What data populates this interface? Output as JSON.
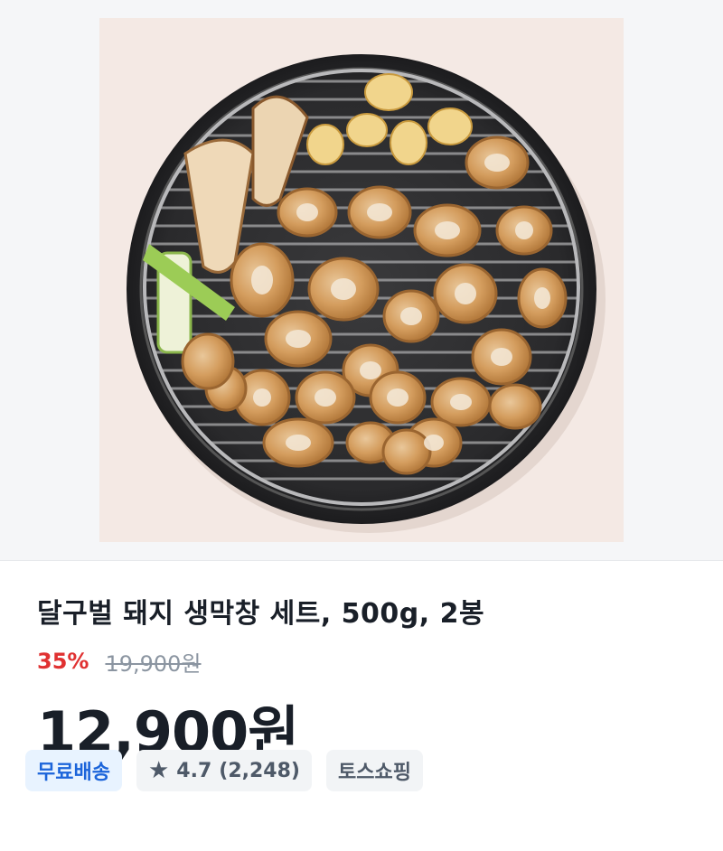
{
  "product": {
    "image_alt": "grilled pork intestines with garlic, king oyster mushroom and green onion on a round grill",
    "title": "달구벌 돼지 생막창 세트, 500g, 2봉",
    "discount": "35%",
    "original_price": "19,900원",
    "price": "12,900원"
  },
  "tags": {
    "shipping": "무료배송",
    "rating_icon": "★",
    "rating": "4.7",
    "review_count": "(2,248)",
    "seller": "토스쇼핑"
  },
  "colors": {
    "discount": "#e03131",
    "shipping_badge_text": "#1b64da",
    "shipping_badge_bg": "#e8f3ff",
    "tag_bg": "#f2f4f6",
    "title": "#191f28"
  }
}
